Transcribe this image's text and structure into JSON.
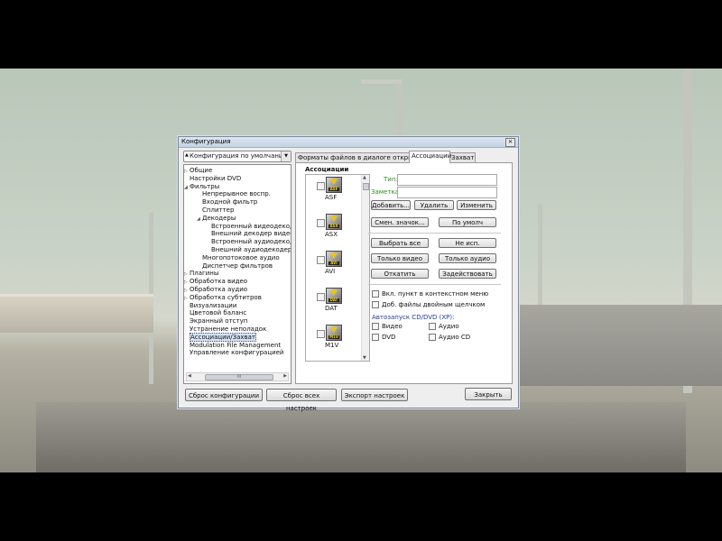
{
  "window": {
    "title": "Конфигурация",
    "close_glyph": "✕"
  },
  "profile": {
    "value": "Конфигурация по умолчанию"
  },
  "tree": {
    "items": [
      {
        "label": "Общие",
        "expander": "▷",
        "level": 0
      },
      {
        "label": "Настройки DVD",
        "expander": "",
        "level": 0
      },
      {
        "label": "Фильтры",
        "expander": "◢",
        "level": 0
      },
      {
        "label": "Непрерывное воспр.",
        "expander": "",
        "level": 1
      },
      {
        "label": "Входной фильтр",
        "expander": "",
        "level": 1
      },
      {
        "label": "Сплиттер",
        "expander": "",
        "level": 1
      },
      {
        "label": "Декодеры",
        "expander": "◢",
        "level": 1
      },
      {
        "label": "Встроенный видеодекодер",
        "expander": "",
        "level": 2
      },
      {
        "label": "Внешний декодер видео",
        "expander": "",
        "level": 2
      },
      {
        "label": "Встроенный аудиодекодер",
        "expander": "",
        "level": 2
      },
      {
        "label": "Внешний аудиодекодер",
        "expander": "",
        "level": 2
      },
      {
        "label": "Многопотоковое аудио",
        "expander": "",
        "level": 1
      },
      {
        "label": "Диспетчер фильтров",
        "expander": "",
        "level": 1
      },
      {
        "label": "Плагины",
        "expander": "▷",
        "level": 0
      },
      {
        "label": "Обработка видео",
        "expander": "▷",
        "level": 0
      },
      {
        "label": "Обработка аудио",
        "expander": "▷",
        "level": 0
      },
      {
        "label": "Обработка субтитров",
        "expander": "▷",
        "level": 0
      },
      {
        "label": "Визуализации",
        "expander": "",
        "level": 0
      },
      {
        "label": "Цветовой баланс",
        "expander": "",
        "level": 0
      },
      {
        "label": "Экранный отступ",
        "expander": "",
        "level": 0
      },
      {
        "label": "Устранение неполадок",
        "expander": "",
        "level": 0
      },
      {
        "label": "Ассоциации/Захват",
        "expander": "",
        "level": 0,
        "selected": true
      },
      {
        "label": "Modulation File Management",
        "expander": "",
        "level": 0
      },
      {
        "label": "Управление конфигурацией",
        "expander": "",
        "level": 0
      }
    ],
    "scroll_grip": "III"
  },
  "tabs": [
    {
      "label": "Форматы файлов в диалоге открытия",
      "active": false
    },
    {
      "label": "Ассоциации",
      "active": true
    },
    {
      "label": "Захват",
      "active": false
    }
  ],
  "assoc": {
    "heading": "Ассоциации",
    "files": [
      {
        "name": "ASF",
        "tag": "ASF"
      },
      {
        "name": "ASX",
        "tag": "ASX"
      },
      {
        "name": "AVI",
        "tag": "AVI"
      },
      {
        "name": "DAT",
        "tag": "DAT"
      },
      {
        "name": "M1V",
        "tag": "M1V"
      }
    ],
    "type_label": "Тип:",
    "note_label": "Заметка:",
    "btn_add": "Добавить...",
    "btn_delete": "Удалить",
    "btn_change": "Изменить",
    "btn_change_icon": "Смен. значок...",
    "btn_default": "По умолч",
    "btn_select_all": "Выбрать все",
    "btn_unused": "Не исп.",
    "btn_video_only": "Только видео",
    "btn_audio_only": "Только аудио",
    "btn_rollback": "Откатить",
    "btn_apply": "Задействовать",
    "chk_context_menu": "Вкл. пункт в контекстном меню",
    "chk_double_click": "Доб. файлы двойным щелчком",
    "autorun_label": "Автозапуск CD/DVD (XP):",
    "chk_video": "Видео",
    "chk_audio": "Аудио",
    "chk_dvd": "DVD",
    "chk_audio_cd": "Аудио CD"
  },
  "bottom": {
    "reset_config": "Сброс конфигурации",
    "reset_all": "Сброс всех настроек",
    "export": "Экспорт настроек",
    "close": "Закрыть"
  }
}
